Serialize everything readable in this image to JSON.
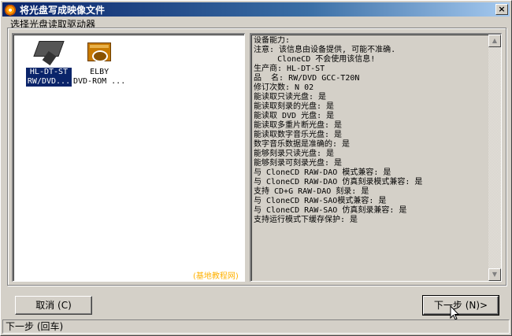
{
  "window": {
    "title": "将光盘写成映像文件",
    "close_glyph": "×"
  },
  "group": {
    "label": "选择光盘读取驱动器"
  },
  "drives": [
    {
      "line1": "HL-DT-ST",
      "line2": "RW/DVD...",
      "selected": true,
      "icon": "optical-drive-icon"
    },
    {
      "line1": "ELBY",
      "line2": "DVD-ROM ...",
      "selected": false,
      "icon": "virtual-drive-icon"
    }
  ],
  "watermark": "(基地教程网)",
  "info": {
    "lines": [
      "设备能力:",
      "注意: 该信息由设备提供, 可能不准确.",
      "     CloneCD 不会使用该信息!",
      "生产商: HL-DT-ST",
      "品  名: RW/DVD GCC-T20N",
      "修订次数: N 02",
      "能读取只读光盘: 是",
      "能读取刻录的光盘: 是",
      "能读取 DVD 光盘: 是",
      "能读取多重片断光盘: 是",
      "能读取数字音乐光盘: 是",
      "数字音乐数据是准确的: 是",
      "能够刻录只读光盘: 是",
      "能够刻录可刻录光盘: 是",
      "与 CloneCD RAW-DAO 模式兼容: 是",
      "与 CloneCD RAW-DAO 仿真刻录模式兼容: 是",
      "支持 CD+G RAW-DAO 刻录: 是",
      "与 CloneCD RAW-SAO模式兼容: 是",
      "与 CloneCD RAW-SAO 仿真刻录兼容: 是",
      "支持运行模式下缓存保护: 是"
    ]
  },
  "buttons": {
    "cancel": "取消 (C)",
    "next": "下一步 (N)>"
  },
  "status": {
    "text": "下一步 (回车)"
  },
  "scrollbar": {
    "up": "▲",
    "down": "▼"
  }
}
